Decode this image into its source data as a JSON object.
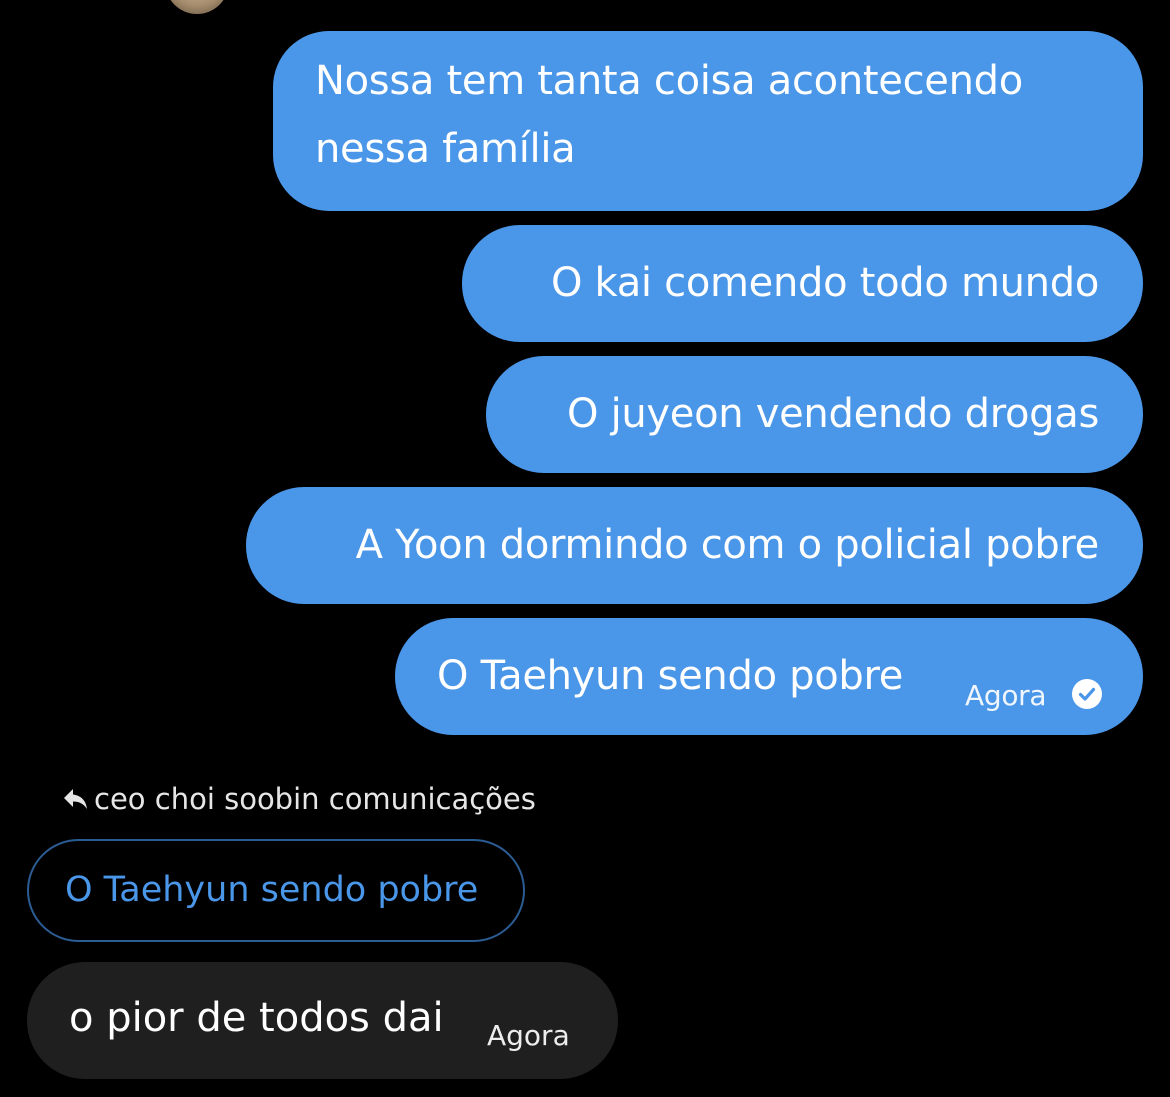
{
  "conversation": {
    "outgoing": [
      {
        "text": "Nossa tem tanta coisa acontecendo nessa família"
      },
      {
        "text": "O kai comendo todo mundo"
      },
      {
        "text": "O juyeon vendendo drogas"
      },
      {
        "text": "A Yoon dormindo com o policial pobre"
      },
      {
        "text": "O Taehyun sendo pobre",
        "time": "Agora",
        "status_icon": "read-check-icon"
      }
    ],
    "reply_context": {
      "icon": "reply-arrow-icon",
      "sender": "ceo choi soobin comunicações",
      "quoted_text": "O Taehyun sendo pobre"
    },
    "incoming": {
      "text": "o pior de todos dai",
      "time": "Agora"
    }
  },
  "colors": {
    "background": "#000000",
    "outgoing_bubble": "#4a96e8",
    "incoming_bubble": "#1f1f1f",
    "quoted_border": "#2b5c93",
    "quoted_text": "#4a96e8"
  }
}
